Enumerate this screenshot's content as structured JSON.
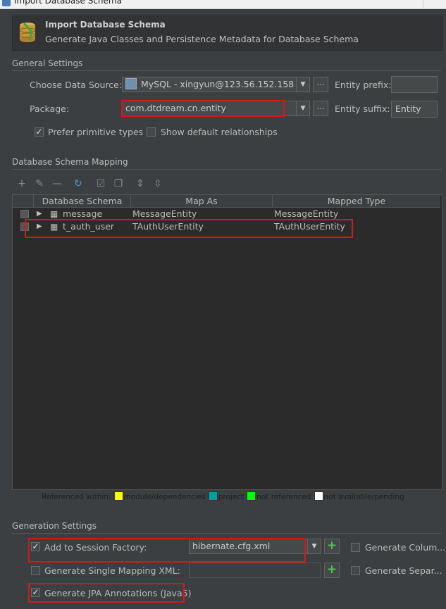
{
  "window": {
    "title": "Import Database Schema"
  },
  "header": {
    "title": "Import Database Schema",
    "subtitle": "Generate Java Classes and Persistence Metadata for Database Schema"
  },
  "general": {
    "section_title": "General Settings",
    "data_source_label": "Choose Data Source:",
    "data_source_value": "MySQL - xingyun@123.56.152.158",
    "entity_prefix_label": "Entity prefix:",
    "entity_prefix_value": "",
    "package_label": "Package:",
    "package_value": "com.dtdream.cn.entity",
    "entity_suffix_label": "Entity suffix:",
    "entity_suffix_value": "Entity",
    "prefer_primitive_label": "Prefer primitive types",
    "prefer_primitive_checked": true,
    "show_default_rel_label": "Show default relationships",
    "show_default_rel_checked": false,
    "dots": "..."
  },
  "mapping": {
    "section_title": "Database Schema Mapping",
    "columns": [
      "Database Schema",
      "Map As",
      "Mapped Type"
    ],
    "rows": [
      {
        "schema": "message",
        "map_as": "MessageEntity",
        "mapped_type": "MessageEntity"
      },
      {
        "schema": "t_auth_user",
        "map_as": "TAuthUserEntity",
        "mapped_type": "TAuthUserEntity"
      }
    ]
  },
  "legend": {
    "prefix": "Referenced within:",
    "items": [
      {
        "label": "module/dependencies",
        "color": "#ffff00"
      },
      {
        "label": "project",
        "color": "#00a0a0"
      },
      {
        "label": "not referenced",
        "color": "#00ff00"
      },
      {
        "label": "not available/pending",
        "color": "#ffffff"
      }
    ]
  },
  "generation": {
    "section_title": "Generation Settings",
    "session_factory_label": "Add to Session Factory:",
    "session_factory_checked": true,
    "session_factory_value": "hibernate.cfg.xml",
    "single_mapping_label": "Generate Single Mapping XML:",
    "single_mapping_checked": false,
    "generate_column_label": "Generate Colum...",
    "generate_separate_label": "Generate Separ...",
    "jpa_label": "Generate JPA Annotations (Java5)",
    "jpa_checked": true
  },
  "colors": {
    "highlight_red": "#d01a1a",
    "background": "#3c3f41",
    "table_bg": "#2b2b2b"
  }
}
